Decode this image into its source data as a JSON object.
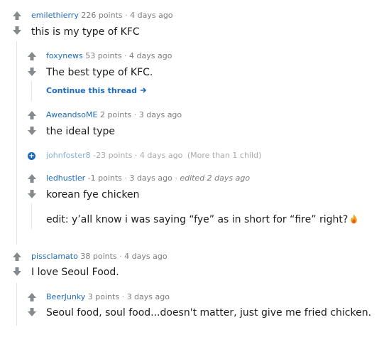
{
  "comments": [
    {
      "user": "emilethierry",
      "points": "226 points",
      "sep": "·",
      "age": "4 days ago",
      "text": "this is my type of KFC"
    },
    {
      "user": "foxynews",
      "points": "53 points",
      "sep": "·",
      "age": "4 days ago",
      "text": "The best type of KFC.",
      "continue_label": "Continue this thread"
    },
    {
      "user": "AweandsoME",
      "points": "2 points",
      "sep": "·",
      "age": "3 days ago",
      "text": "the ideal type"
    },
    {
      "user": "johnfoster8",
      "points": "-23 points",
      "sep": "·",
      "age": "4 days ago",
      "child_note": "(More than 1 child)"
    },
    {
      "user": "ledhustler",
      "points": "-1 points",
      "sep": "·",
      "age": "3 days ago",
      "sep2": "·",
      "edited": "edited 2 days ago",
      "text": "korean fye chicken",
      "text2": "edit: y’all know i was saying “fye” as in short for “fire” right?"
    },
    {
      "user": "pissclamato",
      "points": "38 points",
      "sep": "·",
      "age": "4 days ago",
      "text": "I love Seoul Food."
    },
    {
      "user": "BeerJunky",
      "points": "3 points",
      "sep": "·",
      "age": "3 days ago",
      "text": "Seoul food, soul food...doesn't matter, just give me fried chicken."
    }
  ],
  "icons": {
    "upvote": "upvote-arrow-icon",
    "downvote": "downvote-arrow-icon",
    "expand": "expand-plus-icon",
    "continue": "arrow-right-icon",
    "fire": "fire-emoji-icon"
  },
  "colors": {
    "username": "#1f6ab8",
    "arrow": "#878a8c",
    "meta": "#7c7c7c",
    "thread_line": "#e4e4e4"
  }
}
